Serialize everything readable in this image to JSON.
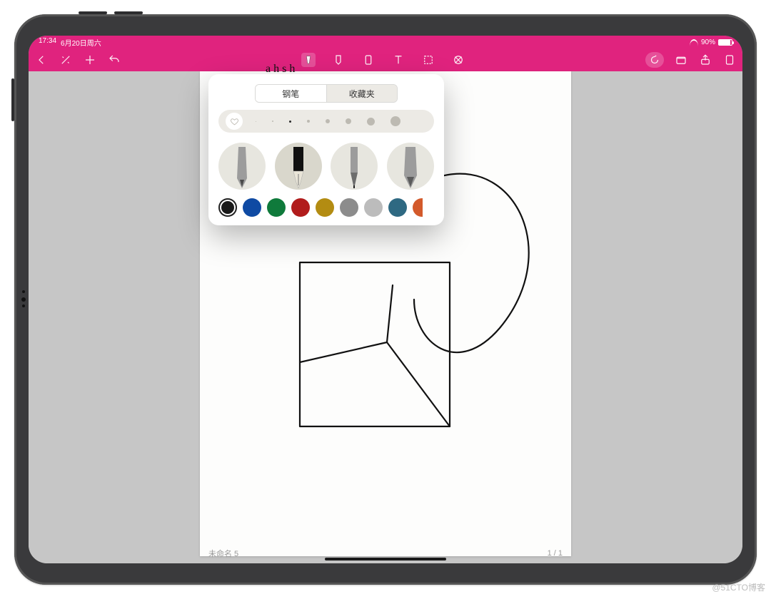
{
  "status": {
    "time": "17:34",
    "date": "6月20日周六",
    "battery_pct": "90%"
  },
  "toolbar": {
    "back": "返回",
    "wand": "工具",
    "add": "添加",
    "undo": "撤销",
    "pen": "钢笔",
    "highlighter": "荧光笔",
    "eraser": "橡皮",
    "text": "T",
    "select": "选择",
    "lasso": "套索",
    "attach": "附件",
    "folder": "文档",
    "share": "分享",
    "more": "更多"
  },
  "doc": {
    "title": "未命名 5",
    "page": "1 / 1"
  },
  "popover": {
    "scribble": "a h s h",
    "tab_pen": "钢笔",
    "tab_fav": "收藏夹",
    "size_dots": [
      1,
      2,
      3,
      4,
      6,
      8,
      11,
      14
    ],
    "selected_size_index": 2,
    "pens": [
      "pencil",
      "fountain",
      "fineliner",
      "graphite"
    ],
    "selected_pen_index": 1,
    "colors": [
      "#1a1a1a",
      "#0f4aa3",
      "#0f7a3b",
      "#b11c1c",
      "#b38c12",
      "#8c8c8c",
      "#bcbcbc",
      "#2e6982",
      "#d35a2b"
    ],
    "selected_color_index": 0
  },
  "watermark": "@51CTO博客"
}
